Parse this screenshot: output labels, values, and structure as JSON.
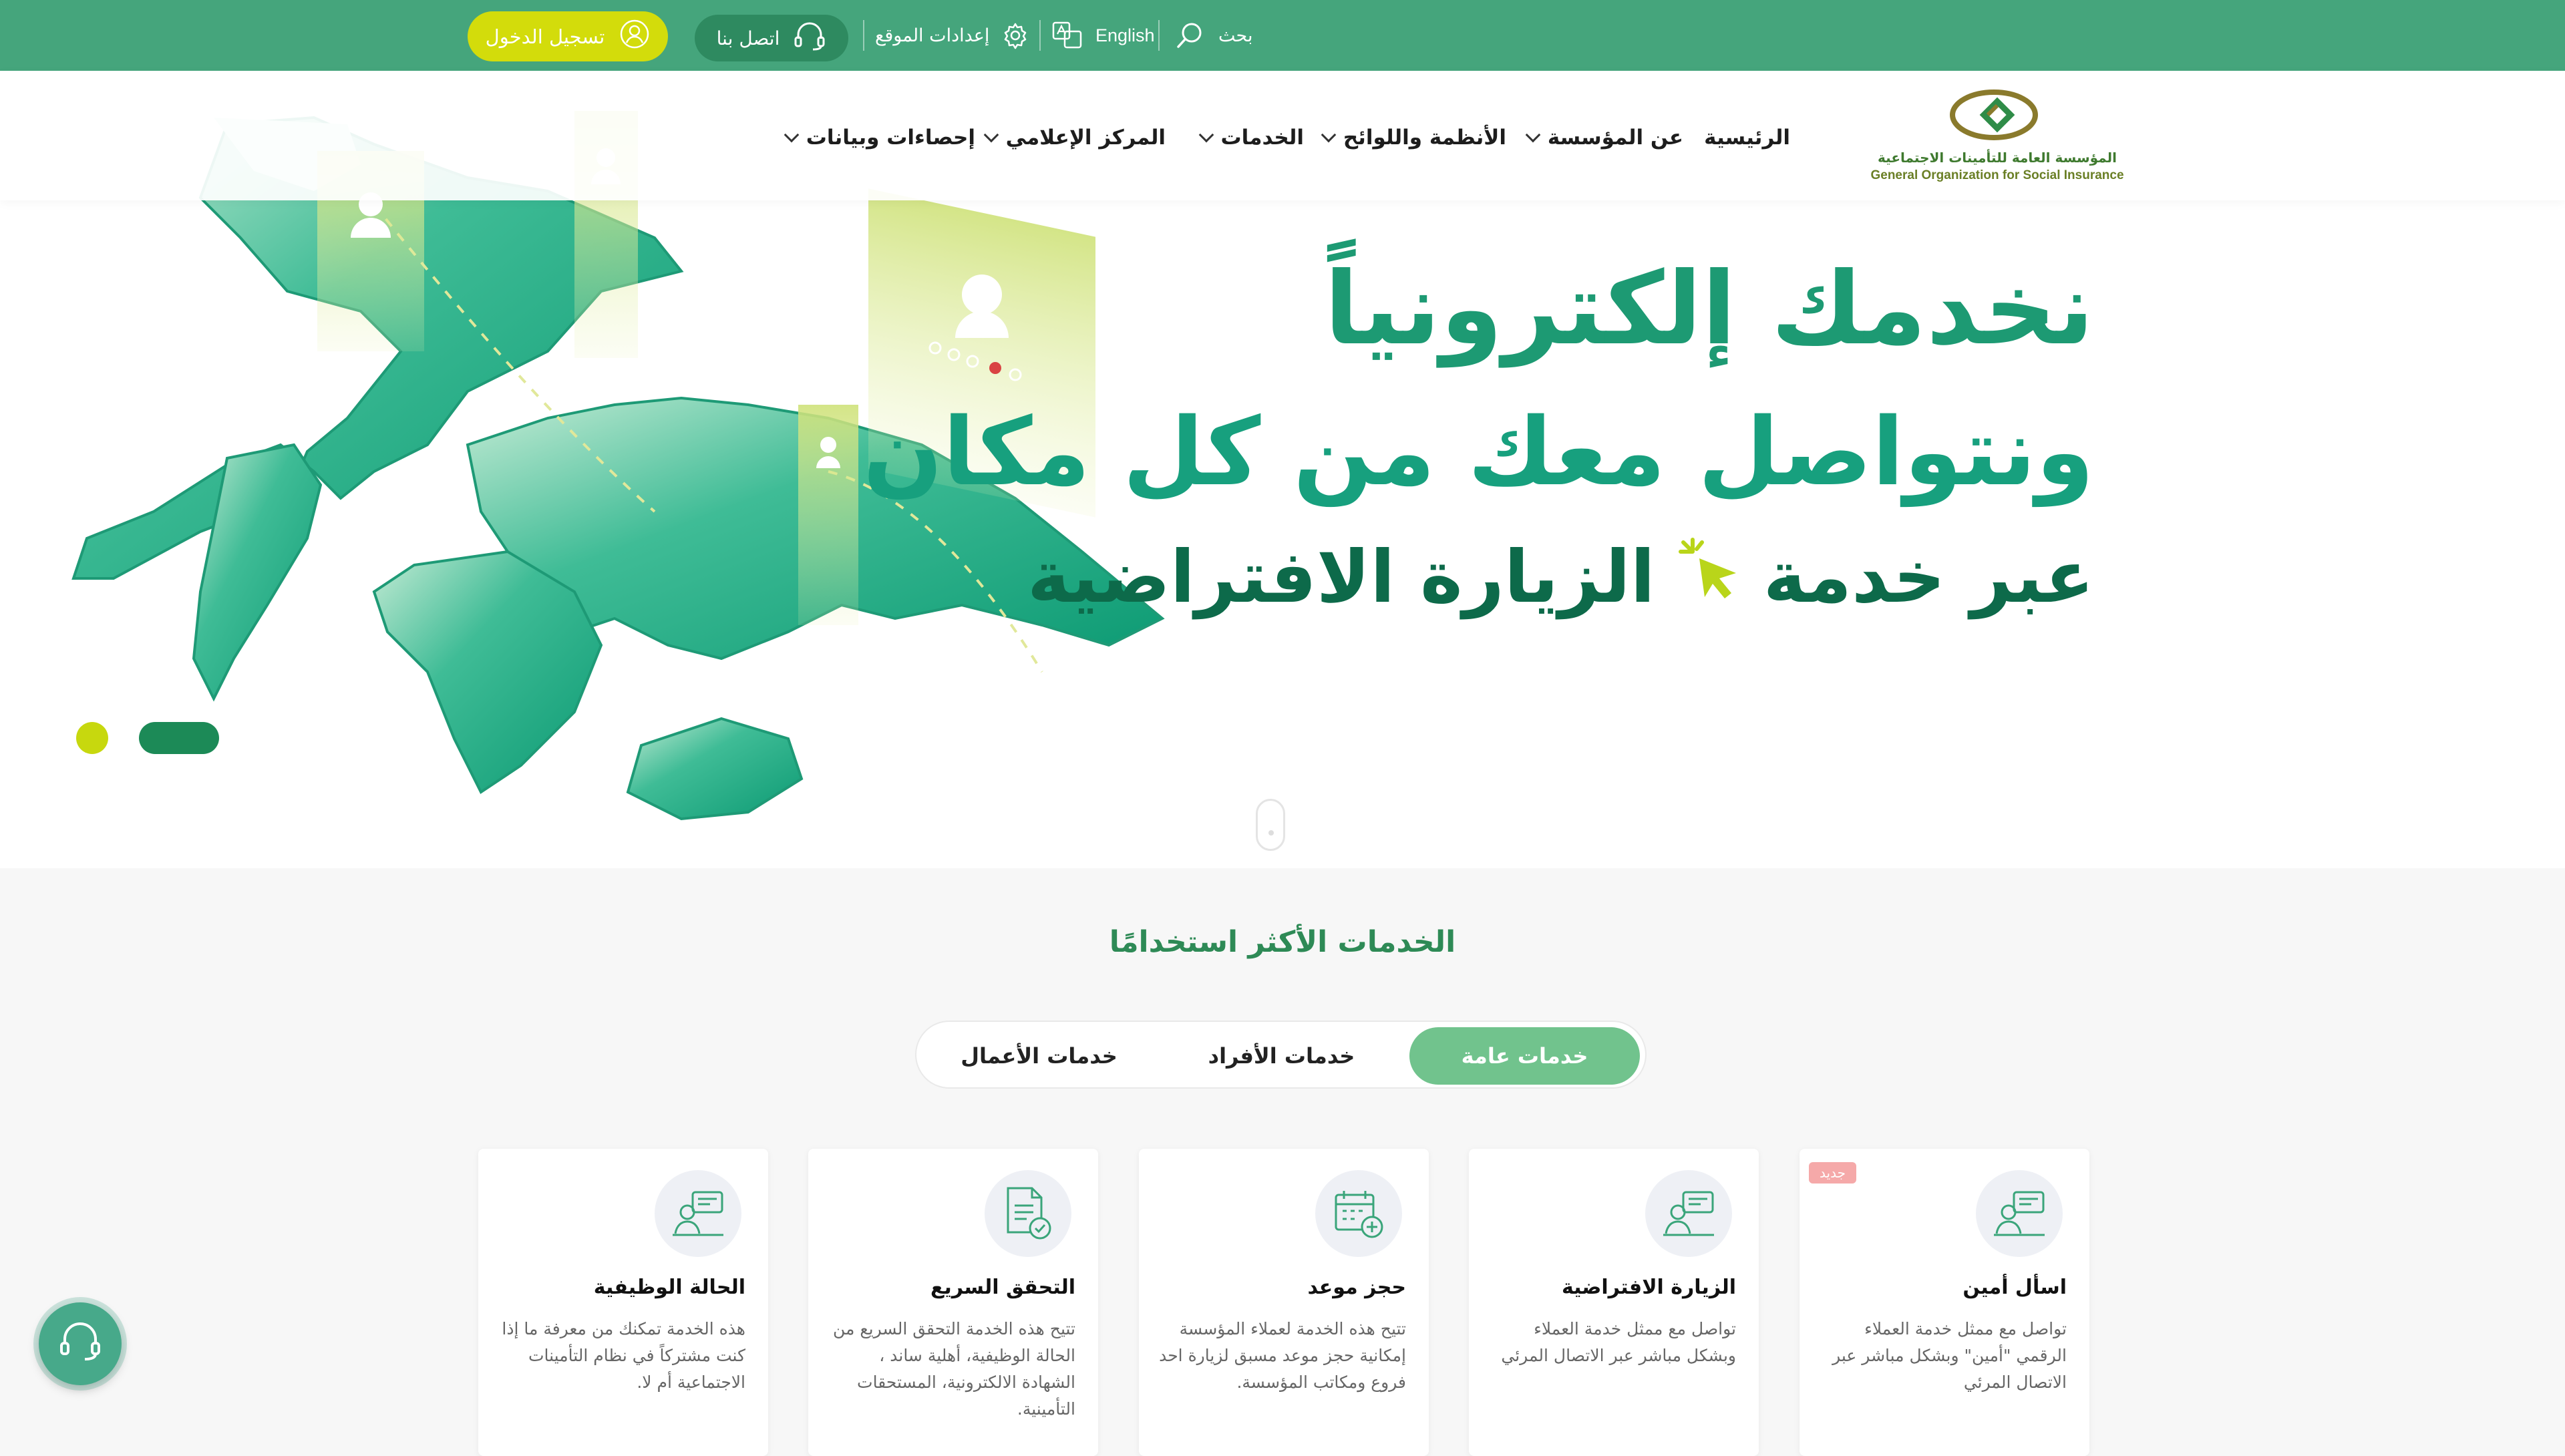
{
  "topbar": {
    "login_label": "تسجيل الدخول",
    "contact_label": "اتصل بنا",
    "settings_label": "إعدادات الموقع",
    "language_label": "English",
    "search_label": "بحث"
  },
  "logo": {
    "arabic": "المؤسسة العامة للتأمينات الاجتماعية",
    "english": "General Organization for Social Insurance"
  },
  "nav": {
    "items": [
      {
        "label": "الرئيسية"
      },
      {
        "label": "عن المؤسسة"
      },
      {
        "label": "الأنظمة واللوائح"
      },
      {
        "label": "الخدمات"
      },
      {
        "label": "المركز الإعلامي"
      },
      {
        "label": "إحصاءات وبيانات"
      }
    ]
  },
  "hero": {
    "line1": "نخدمك إلكترونياً",
    "line2": "ونتواصل معك من كل مكان",
    "line3_prefix": "عبر خدمة",
    "line3_highlight": "الزيارة الافتراضية"
  },
  "services": {
    "title": "الخدمات الأكثر استخدامًا",
    "tabs": [
      {
        "label": "خدمات عامة"
      },
      {
        "label": "خدمات الأفراد"
      },
      {
        "label": "خدمات الأعمال"
      }
    ],
    "cards": [
      {
        "title": "اسأل أمين",
        "badge": "جديد",
        "desc": "تواصل مع ممثل خدمة العملاء الرقمي \"أمين\" وبشكل مباشر عبر الاتصال المرئي",
        "icon": "video-agent-icon"
      },
      {
        "title": "الزيارة الافتراضية",
        "desc": "تواصل مع ممثل خدمة العملاء وبشكل مباشر عبر الاتصال المرئي",
        "icon": "video-agent-icon"
      },
      {
        "title": "حجز موعد",
        "desc": "تتيح هذه الخدمة لعملاء المؤسسة إمكانية حجز موعد مسبق لزيارة احد فروع ومكاتب المؤسسة.",
        "icon": "calendar-add-icon"
      },
      {
        "title": "التحقق السريع",
        "desc": "تتيح هذه الخدمة التحقق السريع من الحالة الوظيفية، أهلية ساند ، الشهادة الالكترونية، المستحقات التأمينية.",
        "icon": "document-check-icon"
      },
      {
        "title": "الحالة الوظيفية",
        "desc": "هذه الخدمة تمكنك من معرفة ما إذا كنت مشتركاً في نظام التأمينات الاجتماعية أم لا.",
        "icon": "video-agent-icon"
      }
    ]
  },
  "colors": {
    "topbar": "#45a57c",
    "accent_yellow": "#d3dc0b",
    "primary_green": "#1d9a73",
    "tab_active": "#71c38d"
  }
}
